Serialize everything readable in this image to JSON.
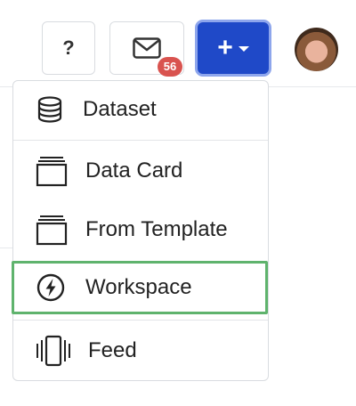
{
  "header": {
    "help_label": "?",
    "mail_badge_count": "56",
    "add_button_label": "+"
  },
  "menu": {
    "items": [
      {
        "label": "Dataset",
        "icon": "database-icon"
      },
      {
        "label": "Data Card",
        "icon": "stacked-card-icon"
      },
      {
        "label": "From Template",
        "icon": "stacked-card-icon"
      },
      {
        "label": "Workspace",
        "icon": "lightning-circle-icon",
        "highlighted": true
      },
      {
        "label": "Feed",
        "icon": "carousel-icon"
      }
    ]
  },
  "colors": {
    "primary": "#1f49c8",
    "badge": "#d9534f",
    "highlight": "#5fb36d"
  }
}
